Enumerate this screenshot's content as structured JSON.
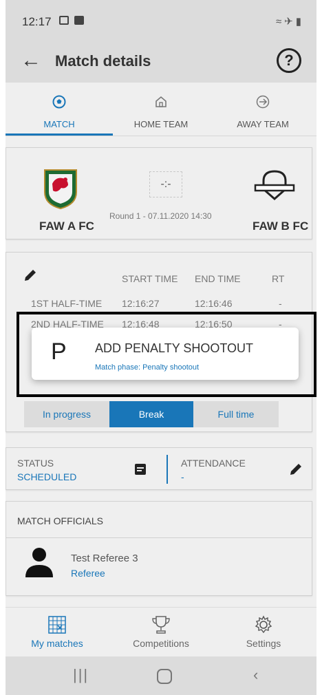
{
  "status_bar": {
    "time": "12:17"
  },
  "app_bar": {
    "title": "Match details",
    "help_symbol": "?"
  },
  "tabs": [
    {
      "label": "MATCH",
      "icon": "soccer-ball-icon",
      "active": true
    },
    {
      "label": "HOME TEAM",
      "icon": "home-icon",
      "active": false
    },
    {
      "label": "AWAY TEAM",
      "icon": "airplane-icon",
      "active": false
    }
  ],
  "match": {
    "home_team": "FAW A FC",
    "away_team": "FAW B FC",
    "score": "-:-",
    "round": "Round 1 - 07.11.2020 14:30"
  },
  "phases": {
    "columns": [
      "START TIME",
      "END TIME",
      "RT"
    ],
    "rows": [
      {
        "name": "1ST HALF-TIME",
        "start": "12:16:27",
        "end": "12:16:46",
        "rt": "-"
      },
      {
        "name": "2ND HALF-TIME",
        "start": "12:16:48",
        "end": "12:16:50",
        "rt": "-"
      }
    ],
    "segments": [
      "In progress",
      "Break",
      "Full time"
    ],
    "active_segment": "Break"
  },
  "dialog": {
    "letter": "P",
    "title": "ADD PENALTY SHOOTOUT",
    "subtitle": "Match phase: Penalty shootout"
  },
  "status": {
    "status_label": "STATUS",
    "status_value": "SCHEDULED",
    "attendance_label": "ATTENDANCE",
    "attendance_value": "-"
  },
  "officials": {
    "heading": "MATCH OFFICIALS",
    "items": [
      {
        "name": "Test Referee 3",
        "role": "Referee"
      }
    ]
  },
  "bottom_nav": [
    {
      "label": "My matches",
      "icon": "calendar-grid-icon",
      "active": true
    },
    {
      "label": "Competitions",
      "icon": "trophy-icon",
      "active": false
    },
    {
      "label": "Settings",
      "icon": "gear-icon",
      "active": false
    }
  ],
  "colors": {
    "accent": "#1976b8",
    "bar": "#dcdcdc",
    "background": "#efefef"
  }
}
